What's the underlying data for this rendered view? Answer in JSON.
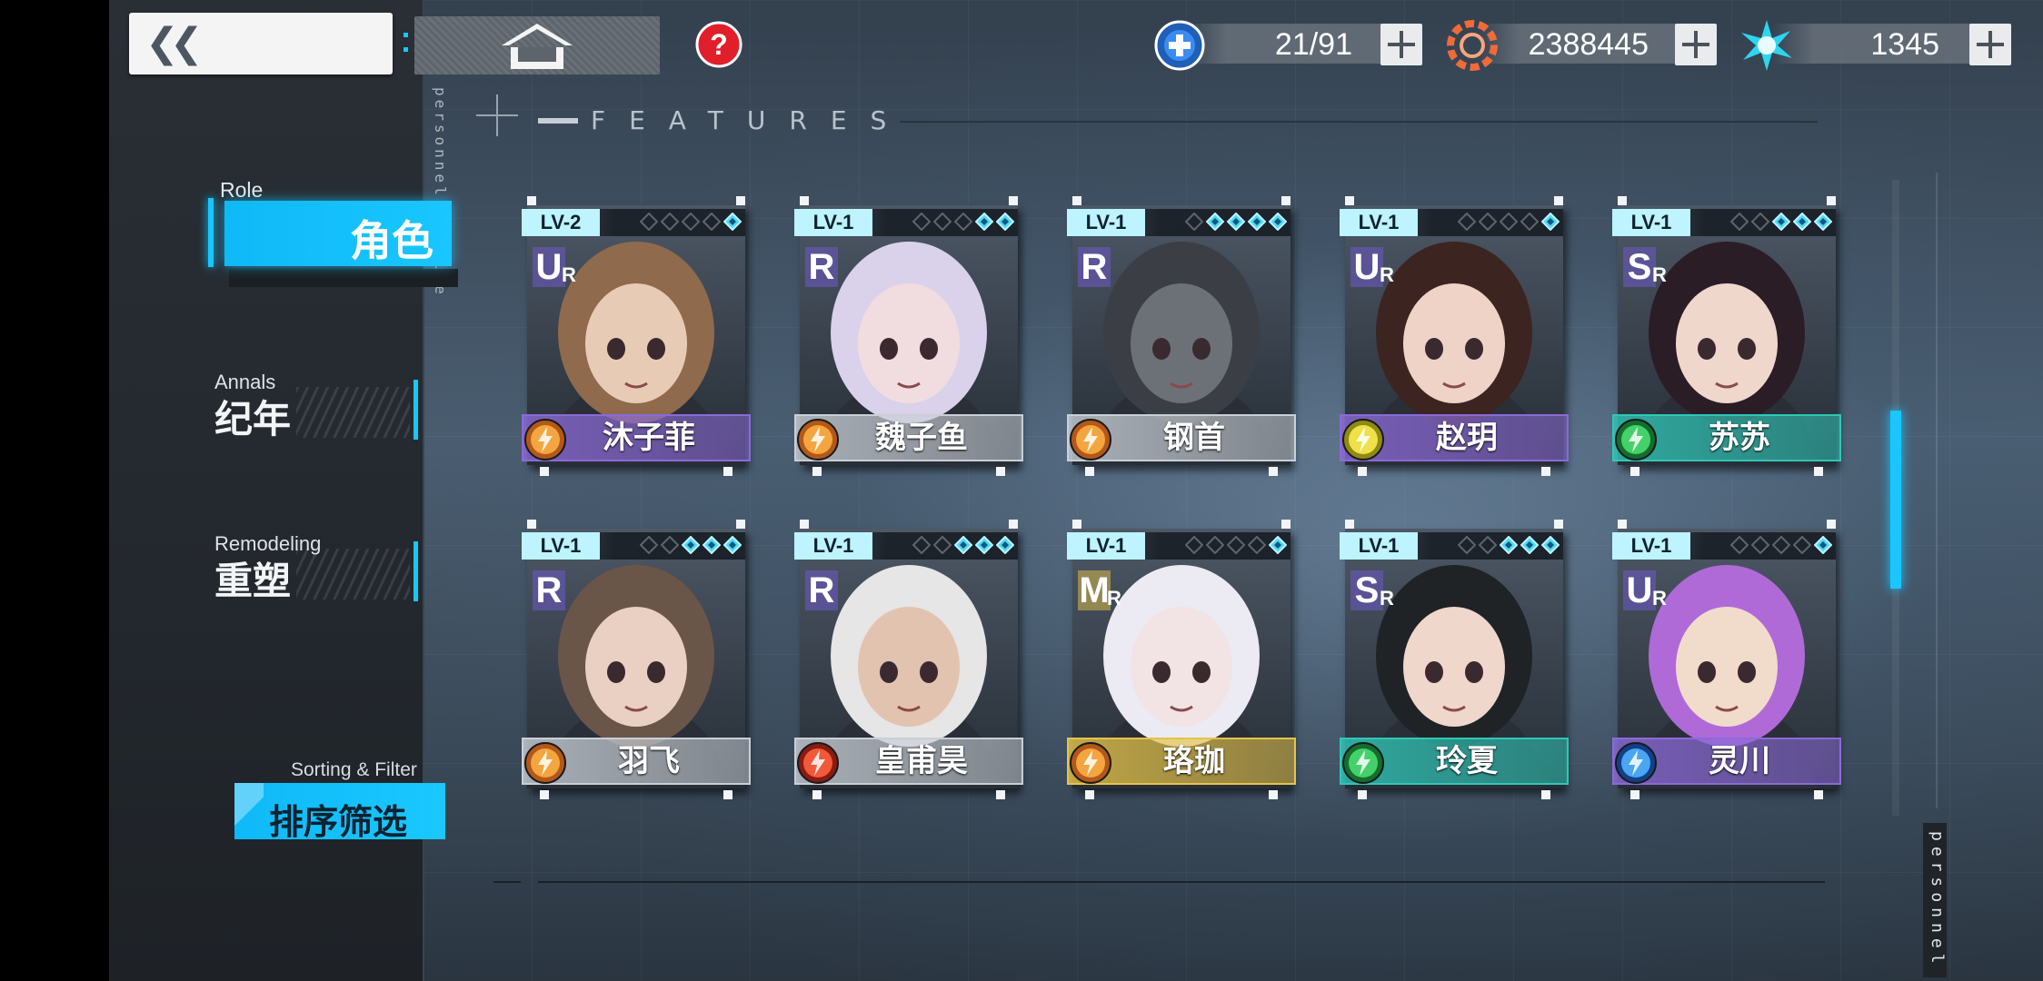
{
  "topbar": {
    "back_icon": "double-chevron-left-icon",
    "home_icon": "home-icon",
    "help_icon": "question-mark-icon",
    "resources": [
      {
        "icon": "stamina-plus-icon",
        "value": "21/91",
        "color": "#3a8cf0"
      },
      {
        "icon": "coin-gear-icon",
        "value": "2388445",
        "color": "#f06a3a"
      },
      {
        "icon": "crystal-burst-icon",
        "value": "1345",
        "color": "#2dd6f0"
      }
    ]
  },
  "header": {
    "label": "FEATURES",
    "vertical_text": "personnel profile",
    "vertical_text_right": "personnel"
  },
  "nav": {
    "role": {
      "en": "Role",
      "zh": "角色"
    },
    "annals": {
      "en": "Annals",
      "zh": "纪年"
    },
    "remodeling": {
      "en": "Remodeling",
      "zh": "重塑"
    },
    "sort": {
      "en": "Sorting & Filter",
      "zh": "排序筛选"
    }
  },
  "accent_color": "#19c6ff",
  "characters": [
    {
      "name": "沐子菲",
      "level": "LV-2",
      "rarity": "U",
      "rarity_sub": "R",
      "element": "lightning",
      "frame": "#8b6ad8",
      "stars": 1,
      "skin": "#e8cbb5",
      "hair": "#8f6a4d"
    },
    {
      "name": "魏子鱼",
      "level": "LV-1",
      "rarity": "R",
      "rarity_sub": "",
      "element": "lightning",
      "frame": "#c9cfd6",
      "stars": 2,
      "skin": "#f1dde0",
      "hair": "#d9d2ea"
    },
    {
      "name": "钢首",
      "level": "LV-1",
      "rarity": "R",
      "rarity_sub": "",
      "element": "lightning",
      "frame": "#c9cfd6",
      "stars": 4,
      "skin": "#6c7178",
      "hair": "#3b3f45"
    },
    {
      "name": "赵玥",
      "level": "LV-1",
      "rarity": "U",
      "rarity_sub": "R",
      "element": "sun",
      "frame": "#8b6ad8",
      "stars": 1,
      "skin": "#efd3c6",
      "hair": "#3c2420"
    },
    {
      "name": "苏苏",
      "level": "LV-1",
      "rarity": "S",
      "rarity_sub": "R",
      "element": "leaf",
      "frame": "#2fc7b8",
      "stars": 3,
      "skin": "#efd7cc",
      "hair": "#2a1d26"
    },
    {
      "name": "羽飞",
      "level": "LV-1",
      "rarity": "R",
      "rarity_sub": "",
      "element": "lightning",
      "frame": "#c9cfd6",
      "stars": 3,
      "skin": "#ead0c2",
      "hair": "#6a5648"
    },
    {
      "name": "皇甫昊",
      "level": "LV-1",
      "rarity": "R",
      "rarity_sub": "",
      "element": "fire",
      "frame": "#c9cfd6",
      "stars": 3,
      "skin": "#e2c3b0",
      "hair": "#e5e6e5"
    },
    {
      "name": "珞珈",
      "level": "LV-1",
      "rarity": "M",
      "rarity_sub": "R",
      "element": "lightning",
      "frame": "#e5c34a",
      "stars": 1,
      "skin": "#f2e3e4",
      "hair": "#eceaf2"
    },
    {
      "name": "玲夏",
      "level": "LV-1",
      "rarity": "S",
      "rarity_sub": "R",
      "element": "leaf",
      "frame": "#2fc7b8",
      "stars": 3,
      "skin": "#efd7cc",
      "hair": "#1f2326"
    },
    {
      "name": "灵川",
      "level": "LV-1",
      "rarity": "U",
      "rarity_sub": "R",
      "element": "water",
      "frame": "#8b6ad8",
      "stars": 1,
      "skin": "#f1dccb",
      "hair": "#b06ad8"
    }
  ]
}
